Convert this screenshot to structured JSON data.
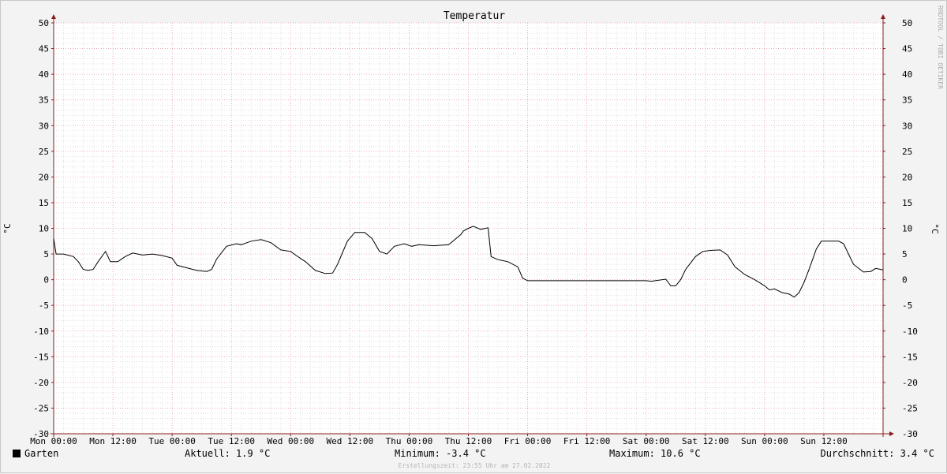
{
  "watermark": "RRDTOOL / TOBI OETIKER",
  "legend": {
    "series_name": "Garten",
    "swatch_color": "#000000",
    "current": "Aktuell: 1.9 °C",
    "minimum": "Minimum: -3.4 °C",
    "maximum": "Maximum: 10.6 °C",
    "average": "Durchschnitt: 3.4 °C"
  },
  "footer": "Erstellungszeit: 23:55 Uhr am 27.02.2022",
  "colors": {
    "major_grid": "#e8a0a8",
    "minor_grid": "#cfcfcf",
    "axis": "#8b1c1c",
    "line": "#000000",
    "plot_bg": "#ffffff"
  },
  "chart_data": {
    "type": "line",
    "title": "Temperatur",
    "ylabel": "°C",
    "ylabel_right": "°C",
    "ylim": [
      -30,
      50
    ],
    "y_ticks": [
      50,
      45,
      40,
      35,
      30,
      25,
      20,
      15,
      10,
      5,
      0,
      -5,
      -10,
      -15,
      -20,
      -25,
      -30
    ],
    "x_unit": "hours since Mon 00:00",
    "xlim": [
      0,
      168
    ],
    "x_ticks": [
      {
        "x": 0,
        "label": "Mon 00:00"
      },
      {
        "x": 12,
        "label": "Mon 12:00"
      },
      {
        "x": 24,
        "label": "Tue 00:00"
      },
      {
        "x": 36,
        "label": "Tue 12:00"
      },
      {
        "x": 48,
        "label": "Wed 00:00"
      },
      {
        "x": 60,
        "label": "Wed 12:00"
      },
      {
        "x": 72,
        "label": "Thu 00:00"
      },
      {
        "x": 84,
        "label": "Thu 12:00"
      },
      {
        "x": 96,
        "label": "Fri 00:00"
      },
      {
        "x": 108,
        "label": "Fri 12:00"
      },
      {
        "x": 120,
        "label": "Sat 00:00"
      },
      {
        "x": 132,
        "label": "Sat 12:00"
      },
      {
        "x": 144,
        "label": "Sun 00:00"
      },
      {
        "x": 156,
        "label": "Sun 12:00"
      }
    ],
    "series": [
      {
        "name": "Garten",
        "color": "#000000",
        "points": [
          [
            0,
            8
          ],
          [
            0.5,
            5
          ],
          [
            2,
            5
          ],
          [
            4,
            4.5
          ],
          [
            5,
            3.5
          ],
          [
            6,
            2
          ],
          [
            7,
            1.8
          ],
          [
            8,
            2
          ],
          [
            9,
            3.5
          ],
          [
            10.5,
            5.5
          ],
          [
            11.5,
            3.5
          ],
          [
            13,
            3.5
          ],
          [
            14.5,
            4.5
          ],
          [
            16,
            5.2
          ],
          [
            18,
            4.8
          ],
          [
            20,
            5
          ],
          [
            22,
            4.7
          ],
          [
            24,
            4.2
          ],
          [
            25,
            2.8
          ],
          [
            27,
            2.3
          ],
          [
            29,
            1.8
          ],
          [
            31,
            1.6
          ],
          [
            32,
            2
          ],
          [
            33,
            4
          ],
          [
            35,
            6.5
          ],
          [
            37,
            7
          ],
          [
            38,
            6.8
          ],
          [
            40,
            7.5
          ],
          [
            42,
            7.8
          ],
          [
            44,
            7.2
          ],
          [
            46,
            5.8
          ],
          [
            48,
            5.5
          ],
          [
            49,
            4.8
          ],
          [
            51,
            3.5
          ],
          [
            53,
            1.8
          ],
          [
            55,
            1.2
          ],
          [
            56.5,
            1.3
          ],
          [
            57.5,
            3
          ],
          [
            59.5,
            7.5
          ],
          [
            61,
            9.2
          ],
          [
            63,
            9.2
          ],
          [
            64.5,
            8
          ],
          [
            66,
            5.5
          ],
          [
            67.5,
            5
          ],
          [
            69,
            6.5
          ],
          [
            71,
            7
          ],
          [
            72.5,
            6.5
          ],
          [
            74,
            6.8
          ],
          [
            77,
            6.6
          ],
          [
            80,
            6.8
          ],
          [
            82.5,
            8.8
          ],
          [
            83,
            9.5
          ],
          [
            84,
            10
          ],
          [
            85,
            10.4
          ],
          [
            86.5,
            9.8
          ],
          [
            88,
            10.1
          ],
          [
            88.6,
            4.5
          ],
          [
            90,
            3.9
          ],
          [
            92,
            3.5
          ],
          [
            94,
            2.5
          ],
          [
            95,
            0.3
          ],
          [
            96,
            -0.2
          ],
          [
            100,
            -0.2
          ],
          [
            110,
            -0.2
          ],
          [
            120,
            -0.2
          ],
          [
            121,
            -0.3
          ],
          [
            124,
            0.1
          ],
          [
            125,
            -1.2
          ],
          [
            126,
            -1.2
          ],
          [
            127,
            0
          ],
          [
            128,
            2
          ],
          [
            130,
            4.5
          ],
          [
            131.5,
            5.5
          ],
          [
            133,
            5.7
          ],
          [
            135,
            5.8
          ],
          [
            136.5,
            4.8
          ],
          [
            138,
            2.5
          ],
          [
            140,
            1
          ],
          [
            142,
            0
          ],
          [
            144,
            -1.2
          ],
          [
            145,
            -2
          ],
          [
            146,
            -1.8
          ],
          [
            147.5,
            -2.5
          ],
          [
            149,
            -2.8
          ],
          [
            150,
            -3.4
          ],
          [
            151,
            -2.5
          ],
          [
            152,
            -0.5
          ],
          [
            153,
            2
          ],
          [
            154.5,
            6
          ],
          [
            155.5,
            7.5
          ],
          [
            157,
            7.5
          ],
          [
            159,
            7.5
          ],
          [
            160,
            7
          ],
          [
            161,
            5
          ],
          [
            162,
            3
          ],
          [
            164,
            1.5
          ],
          [
            165.5,
            1.6
          ],
          [
            166.5,
            2.2
          ],
          [
            168,
            1.9
          ]
        ]
      }
    ]
  }
}
